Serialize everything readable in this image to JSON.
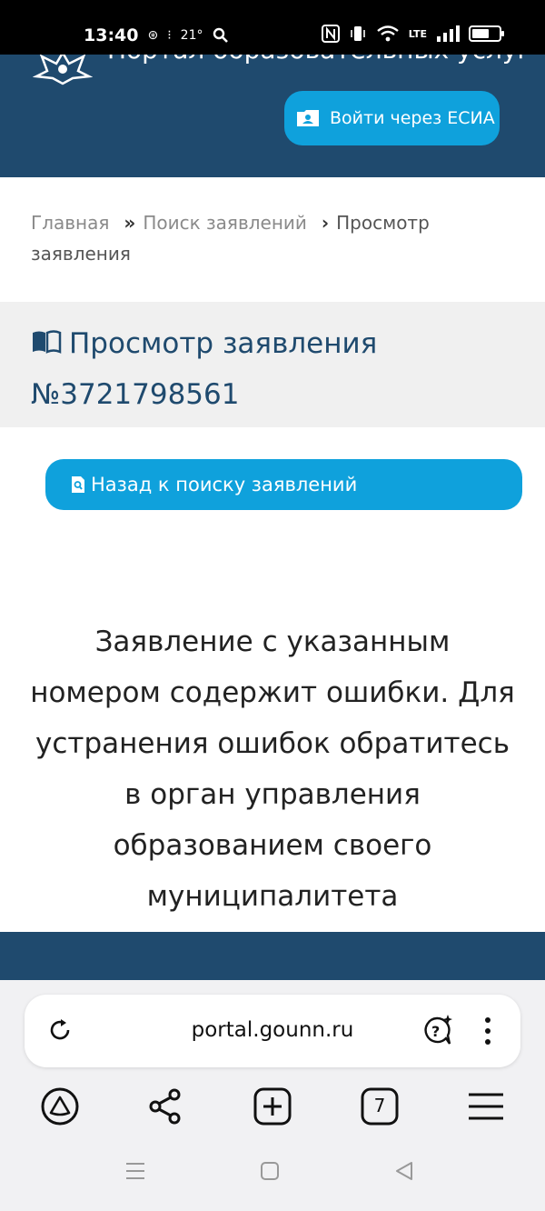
{
  "status_bar": {
    "time": "13:40",
    "temperature": "21°",
    "network": "LTE"
  },
  "header": {
    "site_title": "Портал образовательных услуг",
    "esia_button": "Войти через ЕСИА"
  },
  "breadcrumb": {
    "items": [
      "Главная",
      "Поиск заявлений",
      "Просмотр заявления"
    ],
    "separators": [
      "»",
      "›"
    ]
  },
  "page": {
    "title": "Просмотр заявления №3721798561",
    "back_button": "Назад к поиску заявлений",
    "message": "Заявление с указанным номером содержит ошибки. Для устранения ошибок обратитесь в орган управления образованием своего муниципалитета"
  },
  "browser": {
    "url": "portal.gounn.ru",
    "tab_count": "7"
  },
  "colors": {
    "header_bg": "#1f4a6e",
    "accent": "#0fa1dc",
    "title_color": "#1f4a6e"
  },
  "icons": [
    "emblem-icon",
    "id-card-icon",
    "book-icon",
    "search-doc-icon",
    "reload-icon",
    "assistant-icon",
    "more-icon",
    "alice-icon",
    "share-icon",
    "new-tab-icon",
    "tabs-icon",
    "menu-icon",
    "nav-recents-icon",
    "nav-home-icon",
    "nav-back-icon"
  ]
}
